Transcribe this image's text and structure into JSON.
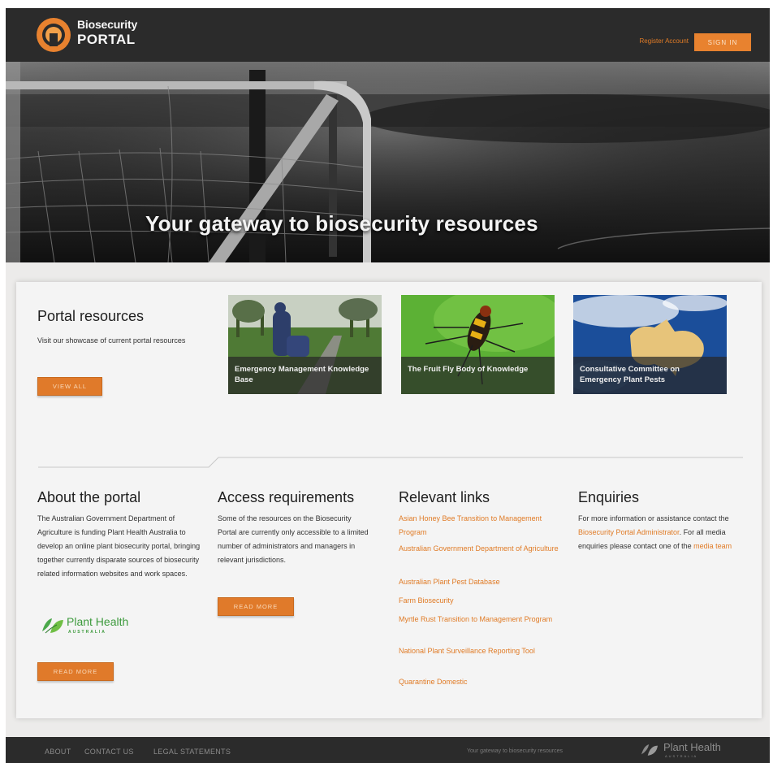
{
  "header": {
    "logo_line1": "Biosecurity",
    "logo_line2": "PORTAL",
    "register_label": "Register Account",
    "signin_label": "SIGN IN"
  },
  "hero": {
    "title": "Your gateway to biosecurity resources"
  },
  "resources": {
    "title": "Portal resources",
    "description": "Visit our showcase of current portal resources",
    "button_label": "VIEW ALL",
    "tiles": [
      {
        "caption": "Emergency Management Knowledge Base"
      },
      {
        "caption": "The Fruit Fly Body of Knowledge"
      },
      {
        "caption": "Consultative Committee on Emergency Plant Pests"
      }
    ]
  },
  "about": {
    "title": "About the portal",
    "text": "The Australian Government Department of Agriculture is funding Plant Health Australia to develop an online plant biosecurity portal, bringing together currently disparate sources of biosecurity related information websites and work spaces.",
    "partner_name": "Plant Health",
    "partner_sub": "AUSTRALIA",
    "button_label": "READ MORE"
  },
  "access": {
    "title": "Access requirements",
    "text": "Some of the resources on the Biosecurity Portal are currently only accessible to a limited number of administrators and managers in relevant jurisdictions.",
    "button_label": "READ MORE"
  },
  "links": {
    "title": "Relevant links",
    "items": [
      "Asian Honey Bee Transition to Management Program",
      "Australian Government Department of Agriculture",
      "Australian Plant Pest Database",
      "Farm Biosecurity",
      "Myrtle Rust Transition to Management Program",
      "National Plant Surveillance Reporting Tool",
      "Quarantine Domestic"
    ]
  },
  "enquiries": {
    "title": "Enquiries",
    "text_a": "For more information or assistance contact the ",
    "link_a": "Biosecurity Portal Administrator",
    "text_b": ". For all media enquiries please contact one of the ",
    "link_b": "media team"
  },
  "footer": {
    "nav": [
      "ABOUT",
      "CONTACT US",
      "LEGAL STATEMENTS"
    ],
    "tagline": "Your gateway to biosecurity resources",
    "logo_text": "Plant Health",
    "logo_sub": "AUSTRALIA"
  },
  "colors": {
    "accent": "#e07b26",
    "header_bg": "#2b2b2b",
    "page_bg": "#ecebea"
  }
}
